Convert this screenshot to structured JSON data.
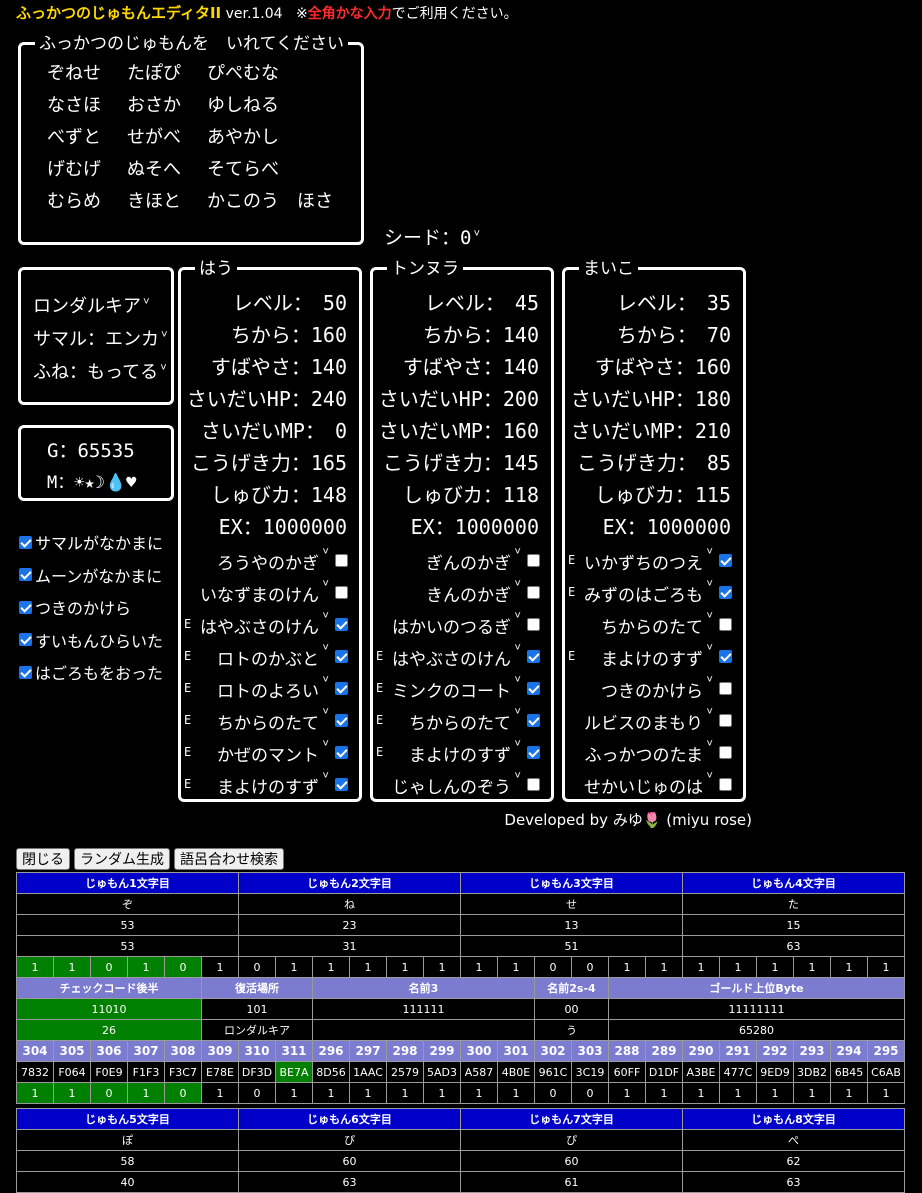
{
  "header": {
    "title": "ふっかつのじゅもんエディタII",
    "version": "ver.1.04",
    "note_prefix": "※",
    "note_emph": "全角かな入力",
    "note_suffix": "でご利用ください。"
  },
  "password_box": {
    "caption": "ふっかつのじゅもんを　いれてください",
    "rows": [
      [
        "ぞねせ",
        "たぽぴ",
        "ぴぺむな"
      ],
      [
        "なさほ",
        "おさか",
        "ゆしねる"
      ],
      [
        "べずと",
        "せがべ",
        "あやかし"
      ],
      [
        "げむげ",
        "ぬそへ",
        "そてらべ"
      ],
      [
        "むらめ",
        "きほと",
        "かこのう　ほさ"
      ]
    ]
  },
  "seed": {
    "label": "シード：0"
  },
  "options": {
    "location": "ロンダルキア",
    "sumaru": "サマル：エンカ",
    "ship": "ふね：もってる"
  },
  "gold_box": {
    "gold": "G：65535",
    "marks": "M：☀★☽💧♥"
  },
  "flags": [
    {
      "label": "サマルがなかまに",
      "checked": true
    },
    {
      "label": "ムーンがなかまに",
      "checked": true
    },
    {
      "label": "つきのかけら",
      "checked": true
    },
    {
      "label": "すいもんひらいた",
      "checked": true
    },
    {
      "label": "はごろもをおった",
      "checked": true
    }
  ],
  "characters": [
    {
      "name": "はう",
      "stats": [
        "レベル：　50",
        "ちから：160",
        "すばやさ：140",
        "さいだいHP：240",
        "さいだいMP：　0",
        "こうげき力：165",
        "しゅびカ：148",
        "EX：1000000"
      ],
      "items": [
        {
          "e": "",
          "name": "ろうやのかぎ",
          "checked": false
        },
        {
          "e": "",
          "name": "いなずまのけん",
          "checked": false
        },
        {
          "e": "E",
          "name": "はやぶさのけん",
          "checked": true
        },
        {
          "e": "E",
          "name": "ロトのかぶと",
          "checked": true
        },
        {
          "e": "E",
          "name": "ロトのよろい",
          "checked": true
        },
        {
          "e": "E",
          "name": "ちからのたて",
          "checked": true
        },
        {
          "e": "E",
          "name": "かぜのマント",
          "checked": true
        },
        {
          "e": "E",
          "name": "まよけのすず",
          "checked": true
        }
      ]
    },
    {
      "name": "トンヌラ",
      "stats": [
        "レベル：　45",
        "ちから：140",
        "すばやさ：140",
        "さいだいHP：200",
        "さいだいMP：160",
        "こうげき力：145",
        "しゅびカ：118",
        "EX：1000000"
      ],
      "items": [
        {
          "e": "",
          "name": "ぎんのかぎ",
          "checked": false
        },
        {
          "e": "",
          "name": "きんのかぎ",
          "checked": false
        },
        {
          "e": "",
          "name": "はかいのつるぎ",
          "checked": false
        },
        {
          "e": "E",
          "name": "はやぶさのけん",
          "checked": true
        },
        {
          "e": "E",
          "name": "ミンクのコート",
          "checked": true
        },
        {
          "e": "E",
          "name": "ちからのたて",
          "checked": true
        },
        {
          "e": "E",
          "name": "まよけのすず",
          "checked": true
        },
        {
          "e": "",
          "name": "じゃしんのぞう",
          "checked": false
        }
      ]
    },
    {
      "name": "まいこ",
      "stats": [
        "レベル：　35",
        "ちから：　70",
        "すばやさ：160",
        "さいだいHP：180",
        "さいだいMP：210",
        "こうげき力：　85",
        "しゅびカ：115",
        "EX：1000000"
      ],
      "items": [
        {
          "e": "E",
          "name": "いかずちのつえ",
          "checked": true
        },
        {
          "e": "E",
          "name": "みずのはごろも",
          "checked": true
        },
        {
          "e": "",
          "name": "ちからのたて",
          "checked": false
        },
        {
          "e": "E",
          "name": "まよけのすず",
          "checked": true
        },
        {
          "e": "",
          "name": "つきのかけら",
          "checked": false
        },
        {
          "e": "",
          "name": "ルビスのまもり",
          "checked": false
        },
        {
          "e": "",
          "name": "ふっかつのたま",
          "checked": false
        },
        {
          "e": "",
          "name": "せかいじゅのは",
          "checked": false
        }
      ]
    }
  ],
  "credit": {
    "text": "Developed by みゆ",
    "flower": "🌷",
    "suffix": "(miyu rose)"
  },
  "buttons": [
    "閉じる",
    "ランダム生成",
    "語呂合わせ検索"
  ],
  "table1": {
    "headers": [
      "じゅもん1文字目",
      "じゅもん2文字目",
      "じゅもん3文字目",
      "じゅもん4文字目"
    ],
    "chars": [
      "ぞ",
      "ね",
      "せ",
      "た"
    ],
    "row_a": [
      "53",
      "23",
      "13",
      "15"
    ],
    "row_b": [
      "53",
      "31",
      "51",
      "63"
    ],
    "bits": [
      "1",
      "1",
      "0",
      "1",
      "0",
      "1",
      "0",
      "1",
      "1",
      "1",
      "1",
      "1",
      "1",
      "1",
      "0",
      "0",
      "1",
      "1",
      "1",
      "1",
      "1",
      "1",
      "1",
      "1"
    ],
    "bits_green": 5,
    "info_headers": [
      "チェックコード後半",
      "復活場所",
      "名前3",
      "名前2s-4",
      "ゴールド上位Byte"
    ],
    "info_row1": [
      "11010",
      "101",
      "111111",
      "00",
      "11111111"
    ],
    "info_row2": [
      "26",
      "ロンダルキア",
      "",
      "う",
      "65280"
    ],
    "idx": [
      "304",
      "305",
      "306",
      "307",
      "308",
      "309",
      "310",
      "311",
      "296",
      "297",
      "298",
      "299",
      "300",
      "301",
      "302",
      "303",
      "288",
      "289",
      "290",
      "291",
      "292",
      "293",
      "294",
      "295"
    ],
    "hex": [
      "7832",
      "F064",
      "F0E9",
      "F1F3",
      "F3C7",
      "E78E",
      "DF3D",
      "BE7A",
      "8D56",
      "1AAC",
      "2579",
      "5AD3",
      "A587",
      "4B0E",
      "961C",
      "3C19",
      "60FF",
      "D1DF",
      "A3BE",
      "477C",
      "9ED9",
      "3DB2",
      "6B45",
      "C6AB"
    ],
    "bits2": [
      "1",
      "1",
      "0",
      "1",
      "0",
      "1",
      "0",
      "1",
      "1",
      "1",
      "1",
      "1",
      "1",
      "1",
      "0",
      "0",
      "1",
      "1",
      "1",
      "1",
      "1",
      "1",
      "1",
      "1"
    ]
  },
  "table2": {
    "headers": [
      "じゅもん5文字目",
      "じゅもん6文字目",
      "じゅもん7文字目",
      "じゅもん8文字目"
    ],
    "chars": [
      "ぽ",
      "ぴ",
      "ぴ",
      "ぺ"
    ],
    "row_a": [
      "58",
      "60",
      "60",
      "62"
    ],
    "row_b": [
      "40",
      "63",
      "61",
      "63"
    ]
  }
}
